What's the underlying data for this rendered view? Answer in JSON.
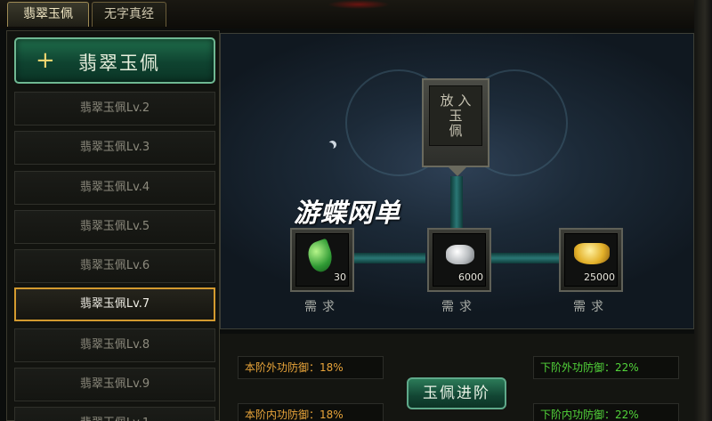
{
  "tabs": [
    {
      "label": "翡翠玉佩",
      "active": true
    },
    {
      "label": "无字真经",
      "active": false
    }
  ],
  "sidebar": {
    "header_label": "翡翠玉佩",
    "header_icon": "plus-icon",
    "items": [
      "翡翠玉佩Lv.2",
      "翡翠玉佩Lv.3",
      "翡翠玉佩Lv.4",
      "翡翠玉佩Lv.5",
      "翡翠玉佩Lv.6",
      "翡翠玉佩Lv.7",
      "翡翠玉佩Lv.8",
      "翡翠玉佩Lv.9",
      "翡翠玉佩Lv.1"
    ],
    "selected_index": 5
  },
  "main": {
    "slot_label": "放入玉佩",
    "slot_lines": [
      "放 入",
      "玉",
      "佩"
    ],
    "watermark": "游蝶网单",
    "requirements": [
      {
        "icon": "jade-leaf-icon",
        "value": "30",
        "label": "需求"
      },
      {
        "icon": "silver-ore-icon",
        "value": "6000",
        "label": "需求"
      },
      {
        "icon": "gold-ingot-icon",
        "value": "25000",
        "label": "需求"
      }
    ]
  },
  "stats": {
    "current_outer_defense": "本阶外功防御：18%",
    "current_inner_defense": "本阶内功防御：18%",
    "next_outer_defense": "下阶外功防御：22%",
    "next_inner_defense": "下阶内功防御：22%"
  },
  "advance_button": "玉佩进阶",
  "colors": {
    "current_stat": "#e8a43a",
    "next_stat": "#52d43a",
    "selected_border": "#d39a2f",
    "accent_green": "#1f6d4b"
  }
}
